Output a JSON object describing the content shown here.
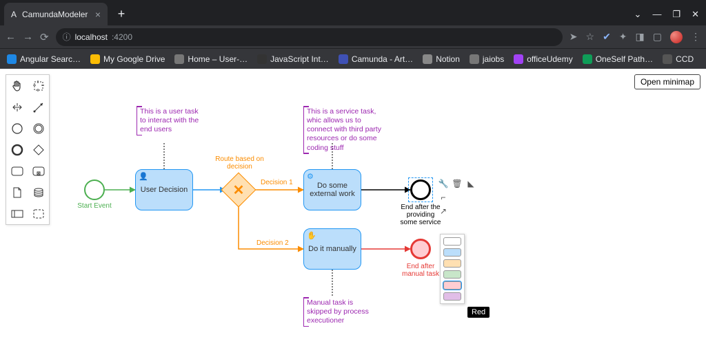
{
  "browser": {
    "tab_title": "CamundaModeler",
    "url_host": "localhost",
    "url_port": ":4200",
    "bookmarks": [
      {
        "label": "Angular Searc…",
        "color": "#1e88e5"
      },
      {
        "label": "My Google Drive",
        "color": "#fbbc04"
      },
      {
        "label": "Home – User-…",
        "color": "#777"
      },
      {
        "label": "JavaScript Int…",
        "color": "#333"
      },
      {
        "label": "Camunda - Art…",
        "color": "#3f51b5"
      },
      {
        "label": "Notion",
        "color": "#888"
      },
      {
        "label": "jaiobs",
        "color": "#777"
      },
      {
        "label": "officeUdemy",
        "color": "#a142f4"
      },
      {
        "label": "OneSelf Path…",
        "color": "#0f9d58"
      },
      {
        "label": "CCD",
        "color": "#555"
      }
    ]
  },
  "app": {
    "open_minimap": "Open minimap"
  },
  "nodes": {
    "start_label": "Start Event",
    "user_task": "User Decision",
    "gateway_label": "Route based on decision",
    "service_task": "Do some external work",
    "manual_task": "Do it manually",
    "decision1": "Decision 1",
    "decision2": "Decision 2",
    "end1": "End after the providing some service",
    "end2": "End after manual task"
  },
  "annotations": {
    "user": "This is a user task to interact with the end users",
    "service": "This is a service task, whic allows us to connect with third party resources or do some coding stuff",
    "manual": "Manual task is skipped by process executioner"
  },
  "color_picker": {
    "tooltip": "Red",
    "colors": [
      "#ffffff",
      "#bbdefb",
      "#ffe0b2",
      "#c8e6c9",
      "#ffcdd2",
      "#e1bee7"
    ]
  },
  "chart_data": {
    "type": "bpmn-diagram",
    "elements": [
      {
        "id": "start",
        "type": "startEvent",
        "label": "Start Event",
        "color": "green"
      },
      {
        "id": "userTask",
        "type": "userTask",
        "label": "User Decision",
        "annotation": "This is a user task to interact with the end users",
        "color": "blue"
      },
      {
        "id": "gateway",
        "type": "exclusiveGateway",
        "label": "Route based on decision",
        "color": "orange"
      },
      {
        "id": "serviceTask",
        "type": "serviceTask",
        "label": "Do some external work",
        "annotation": "This is a service task, whic allows us to connect with third party resources or do some coding stuff",
        "color": "blue"
      },
      {
        "id": "manualTask",
        "type": "manualTask",
        "label": "Do it manually",
        "annotation": "Manual task is skipped by process executioner",
        "color": "blue"
      },
      {
        "id": "end1",
        "type": "endEvent",
        "label": "End after the providing some service",
        "color": "black",
        "selected": true
      },
      {
        "id": "end2",
        "type": "endEvent",
        "label": "End after manual task",
        "color": "red"
      }
    ],
    "flows": [
      {
        "from": "start",
        "to": "userTask",
        "color": "green"
      },
      {
        "from": "userTask",
        "to": "gateway",
        "color": "blue"
      },
      {
        "from": "gateway",
        "to": "serviceTask",
        "label": "Decision 1",
        "color": "orange"
      },
      {
        "from": "gateway",
        "to": "manualTask",
        "label": "Decision 2",
        "color": "orange"
      },
      {
        "from": "serviceTask",
        "to": "end1",
        "color": "black"
      },
      {
        "from": "manualTask",
        "to": "end2",
        "color": "red"
      }
    ]
  }
}
